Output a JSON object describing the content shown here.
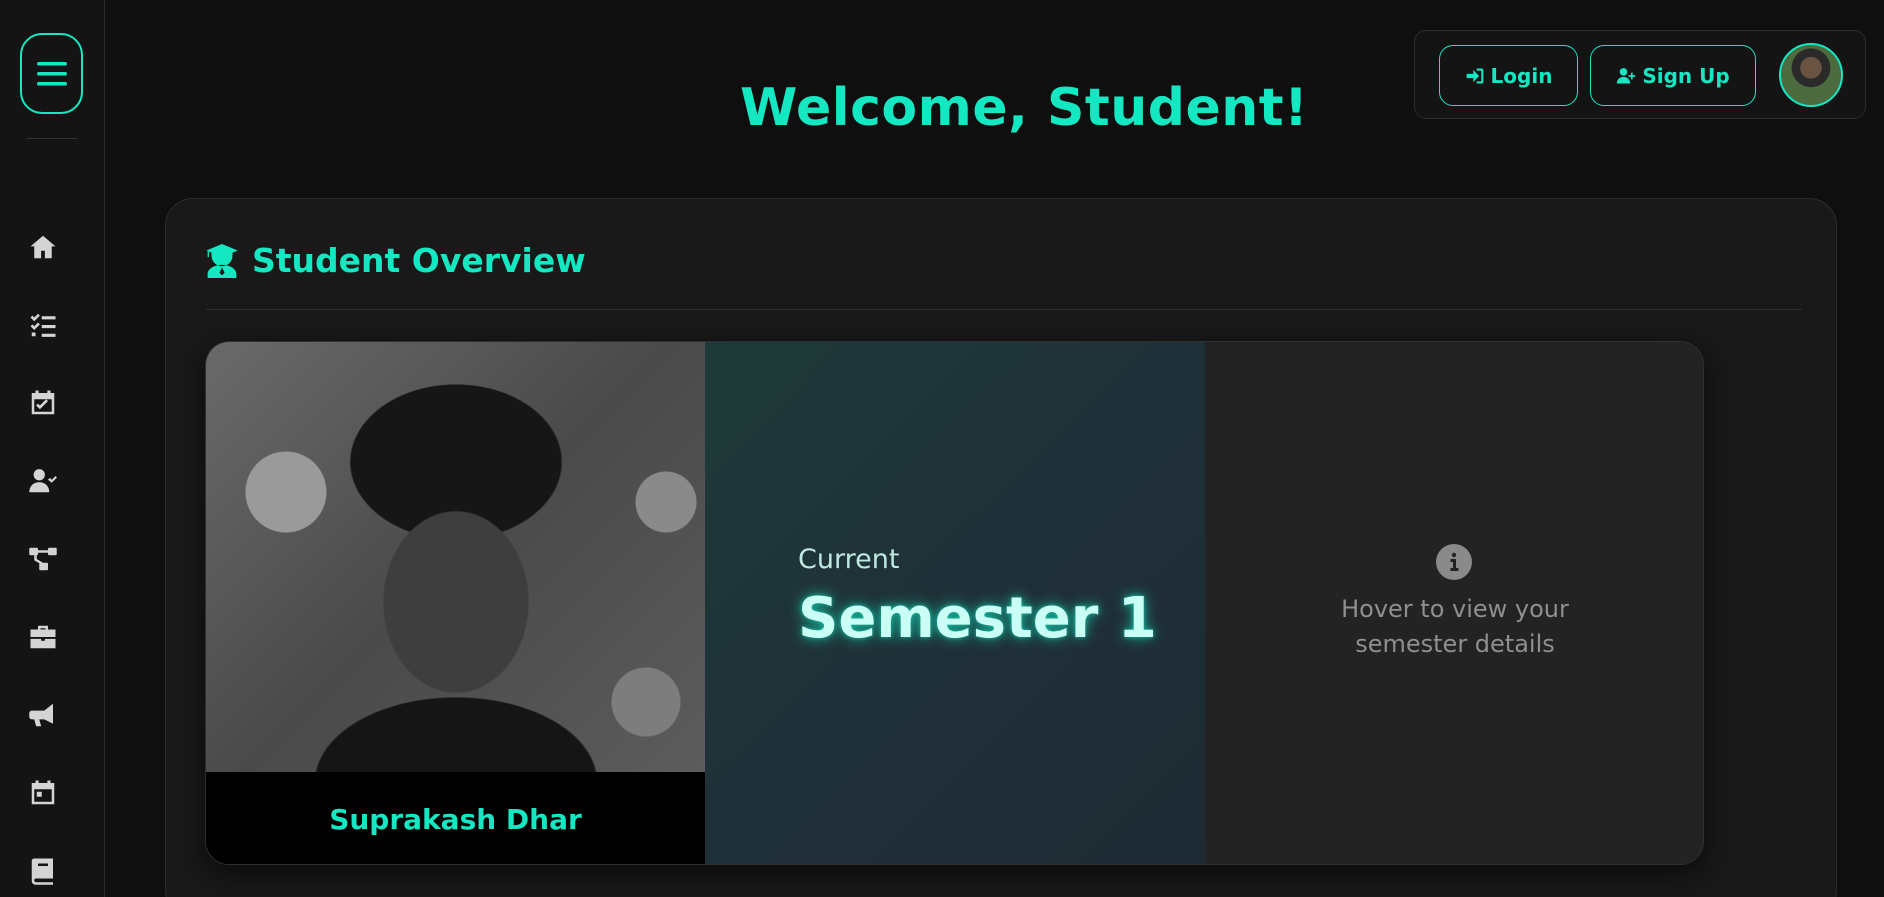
{
  "header": {
    "welcome_title": "Welcome, Student!",
    "login_label": "Login",
    "signup_label": "Sign Up"
  },
  "sidebar": {
    "items": [
      {
        "name": "home-icon"
      },
      {
        "name": "checklist-icon"
      },
      {
        "name": "calendar-check-icon"
      },
      {
        "name": "user-check-icon"
      },
      {
        "name": "network-icon"
      },
      {
        "name": "briefcase-icon"
      },
      {
        "name": "bullhorn-icon"
      },
      {
        "name": "calendar-icon"
      },
      {
        "name": "book-icon"
      }
    ]
  },
  "overview": {
    "title": "Student Overview",
    "student_name": "Suprakash Dhar",
    "semester_label": "Current",
    "semester_value": "Semester 1",
    "hover_hint": "Hover to view your semester details"
  },
  "colors": {
    "accent": "#14e8c2",
    "background": "#0f0f0f",
    "panel": "#191919"
  }
}
